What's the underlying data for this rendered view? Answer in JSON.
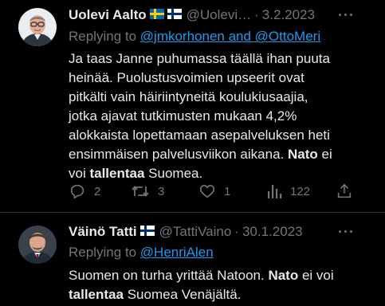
{
  "tweets": [
    {
      "author_name": "Uolevi Aalto",
      "handle": "@Uolevi…",
      "separator": "·",
      "date": "3.2.2023",
      "more": "···",
      "replying_prefix": "Replying to ",
      "replying_to": "@jmkorhonen and @OttoMeri",
      "body": {
        "part1": "Ja taas Janne puhumassa täällä ihan puuta heinää. Puolustusvoimien upseerit ovat pitkälti vain häiriintyneitä koulukiusaajia, jotka ajavat tutkimusten mukaan 4,2% alokkaista lopettamaan asepalveluksen heti ensimmäisen palvelusviikon aikana. ",
        "bold1": "Nato",
        "part2": " ei voi ",
        "bold2": "tallentaa",
        "part3": " Suomea."
      },
      "actions": {
        "replies": "2",
        "retweets": "3",
        "likes": "1",
        "views": "122"
      }
    },
    {
      "author_name": "Väinö Tatti",
      "handle": "@TattiVaino",
      "separator": "·",
      "date": "30.1.2023",
      "more": "···",
      "replying_prefix": "Replying to ",
      "replying_to": "@HenriAlen",
      "body": {
        "part1": "Suomen on turha yrittää Natoon. ",
        "bold1": "Nato",
        "part2": " ei voi ",
        "bold2": "tallentaa",
        "part3": " Suomea Venäjältä."
      }
    }
  ],
  "icons": {
    "flag_sweden": "sweden-flag-icon",
    "flag_finland": "finland-flag-icon",
    "reply": "reply-icon",
    "retweet": "retweet-icon",
    "like": "heart-icon",
    "views": "views-icon",
    "share": "share-icon"
  },
  "colors": {
    "background": "#000000",
    "text": "#e7e9ea",
    "muted": "#71767b",
    "link": "#1d9bf0"
  }
}
